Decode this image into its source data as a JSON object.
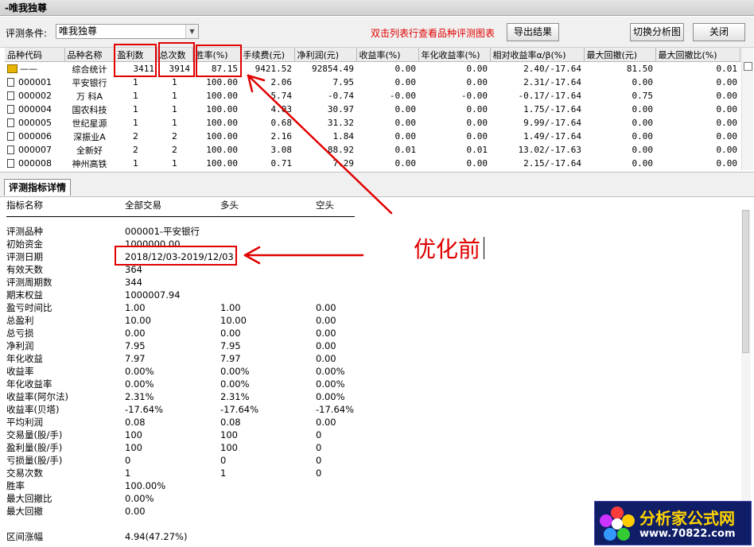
{
  "window": {
    "title": "-唯我独尊"
  },
  "toolbar": {
    "condition_label": "评测条件:",
    "condition_value": "唯我独尊",
    "hint": "双击列表行查看品种评测图表",
    "export_label": "导出结果",
    "switch_label": "切换分析图",
    "close_label": "关闭"
  },
  "grid": {
    "columns": [
      "品种代码",
      "品种名称",
      "盈利数",
      "总次数",
      "胜率(%)",
      "手续费(元)",
      "净利润(元)",
      "收益率(%)",
      "年化收益率(%)",
      "相对收益率α/β(%)",
      "最大回撤(元)",
      "最大回撤比(%)"
    ],
    "rows": [
      [
        "——",
        "综合统计",
        "3411",
        "3914",
        "87.15",
        "9421.52",
        "92854.49",
        "0.00",
        "0.00",
        "2.40/-17.64",
        "81.50",
        "0.01"
      ],
      [
        "000001",
        "平安银行",
        "1",
        "1",
        "100.00",
        "2.06",
        "7.95",
        "0.00",
        "0.00",
        "2.31/-17.64",
        "0.00",
        "0.00"
      ],
      [
        "000002",
        "万 科A",
        "1",
        "1",
        "100.00",
        "5.74",
        "-0.74",
        "-0.00",
        "-0.00",
        "-0.17/-17.64",
        "0.75",
        "0.00"
      ],
      [
        "000004",
        "国农科技",
        "1",
        "1",
        "100.00",
        "4.03",
        "30.97",
        "0.00",
        "0.00",
        "1.75/-17.64",
        "0.00",
        "0.00"
      ],
      [
        "000005",
        "世纪星源",
        "1",
        "1",
        "100.00",
        "0.68",
        "31.32",
        "0.00",
        "0.00",
        "9.99/-17.64",
        "0.00",
        "0.00"
      ],
      [
        "000006",
        "深振业A",
        "2",
        "2",
        "100.00",
        "2.16",
        "1.84",
        "0.00",
        "0.00",
        "1.49/-17.64",
        "0.00",
        "0.00"
      ],
      [
        "000007",
        "全新好",
        "2",
        "2",
        "100.00",
        "3.08",
        "88.92",
        "0.01",
        "0.01",
        "13.02/-17.63",
        "0.00",
        "0.00"
      ],
      [
        "000008",
        "神州高铁",
        "1",
        "1",
        "100.00",
        "0.71",
        "7.29",
        "0.00",
        "0.00",
        "2.15/-17.64",
        "0.00",
        "0.00"
      ]
    ]
  },
  "detail_tab": {
    "label": "评测指标详情"
  },
  "detail": {
    "headers": [
      "指标名称",
      "全部交易",
      "多头",
      "空头"
    ],
    "rows": [
      [
        "评测品种",
        "000001-平安银行",
        "",
        ""
      ],
      [
        "初始资金",
        "1000000.00",
        "",
        ""
      ],
      [
        "评测日期",
        "2018/12/03-2019/12/03",
        "",
        ""
      ],
      [
        "有效天数",
        "364",
        "",
        ""
      ],
      [
        "评测周期数",
        "344",
        "",
        ""
      ],
      [
        "期末权益",
        "1000007.94",
        "",
        ""
      ],
      [
        "盈亏时间比",
        "1.00",
        "1.00",
        "0.00"
      ],
      [
        "总盈利",
        "10.00",
        "10.00",
        "0.00"
      ],
      [
        "总亏损",
        "0.00",
        "0.00",
        "0.00"
      ],
      [
        "净利润",
        "7.95",
        "7.95",
        "0.00"
      ],
      [
        "年化收益",
        "7.97",
        "7.97",
        "0.00"
      ],
      [
        "收益率",
        "0.00%",
        "0.00%",
        "0.00%"
      ],
      [
        "年化收益率",
        "0.00%",
        "0.00%",
        "0.00%"
      ],
      [
        "收益率(阿尔法)",
        "2.31%",
        "2.31%",
        "0.00%"
      ],
      [
        "收益率(贝塔)",
        "-17.64%",
        "-17.64%",
        "-17.64%"
      ],
      [
        "平均利润",
        "0.08",
        "0.08",
        "0.00"
      ],
      [
        "交易量(股/手)",
        "100",
        "100",
        "0"
      ],
      [
        "盈利量(股/手)",
        "100",
        "100",
        "0"
      ],
      [
        "亏损量(股/手)",
        "0",
        "0",
        "0"
      ],
      [
        "交易次数",
        "1",
        "1",
        "0"
      ],
      [
        "胜率",
        "100.00%",
        "",
        ""
      ],
      [
        "最大回撤比",
        "0.00%",
        "",
        ""
      ],
      [
        "最大回撤",
        "0.00",
        "",
        ""
      ],
      [
        "",
        "",
        "",
        ""
      ],
      [
        "区间涨幅",
        "4.94(47.27%)",
        "",
        ""
      ]
    ]
  },
  "annotation": {
    "text": "优化前"
  },
  "watermark": {
    "name": "分析家公式网",
    "url": "www.70822.com"
  },
  "colors": {
    "highlight": "#e00000",
    "logo_bg": "#0f1e66",
    "logo_text": "#ffd400"
  }
}
